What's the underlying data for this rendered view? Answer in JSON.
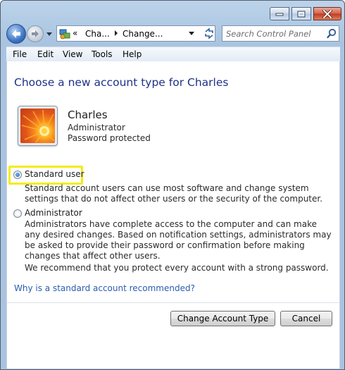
{
  "window": {
    "address": {
      "overflow": "«",
      "crumbs": [
        "Cha...",
        "Change..."
      ]
    },
    "search": {
      "placeholder": "Search Control Panel"
    }
  },
  "menu": {
    "items": [
      "File",
      "Edit",
      "View",
      "Tools",
      "Help"
    ]
  },
  "page": {
    "title": "Choose a new account type for Charles",
    "user": {
      "name": "Charles",
      "type": "Administrator",
      "status": "Password protected"
    },
    "options": {
      "standard": {
        "label": "Standard user",
        "checked": true,
        "description": "Standard account users can use most software and change system settings that do not affect other users or the security of the computer."
      },
      "administrator": {
        "label": "Administrator",
        "checked": false,
        "description": "Administrators have complete access to the computer and can make any desired changes. Based on notification settings, administrators may be asked to provide their password or confirmation before making changes that affect other users."
      }
    },
    "recommendation": "We recommend that you protect every account with a strong password.",
    "help_link": "Why is a standard account recommended?",
    "buttons": {
      "change": "Change Account Type",
      "cancel": "Cancel"
    }
  },
  "colors": {
    "title": "#1e3287",
    "link": "#2a5db0",
    "highlight": "#f2ec1a"
  },
  "icons": [
    "minimize-icon",
    "maximize-icon",
    "close-icon",
    "back-arrow-icon",
    "forward-arrow-icon",
    "control-panel-icon",
    "refresh-icon",
    "search-icon",
    "user-picture"
  ]
}
